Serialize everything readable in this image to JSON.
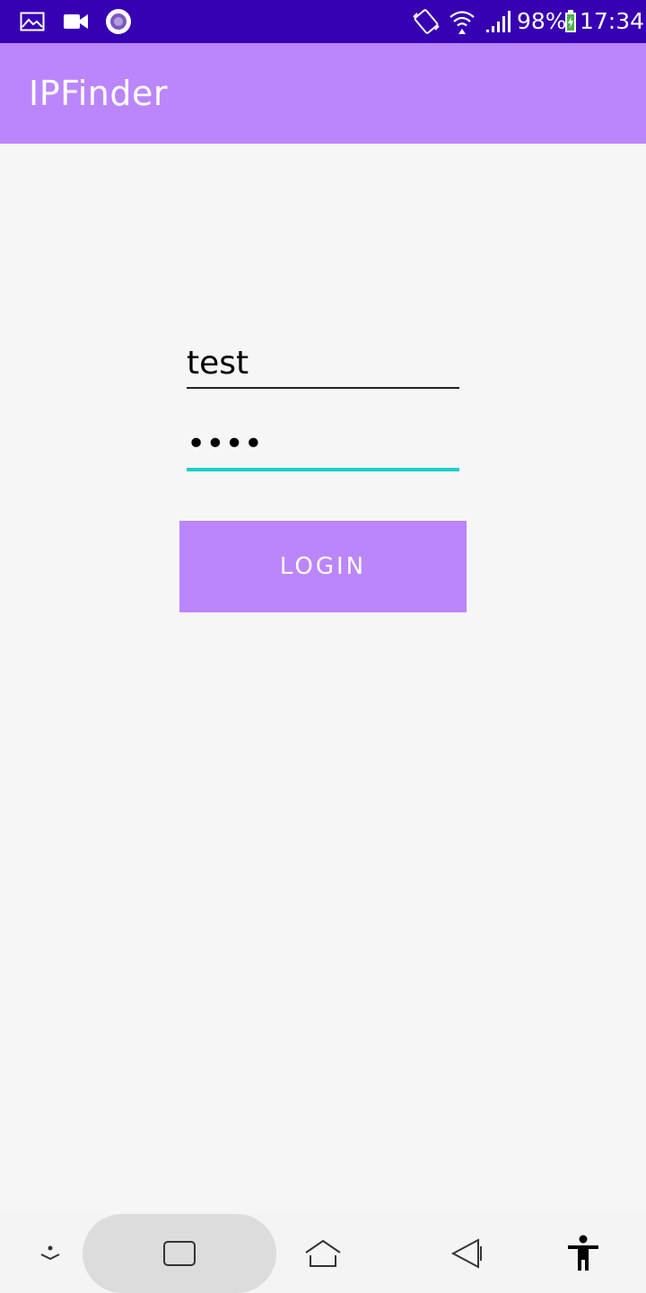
{
  "status_bar": {
    "battery": "98%",
    "time": "17:34",
    "icons": [
      "image-icon",
      "video-camera-icon",
      "record-icon",
      "vibrate-icon",
      "wifi-icon",
      "signal-icon",
      "battery-charging-icon"
    ]
  },
  "app_bar": {
    "title": "IPFinder"
  },
  "form": {
    "username_value": "test",
    "password_value": "test",
    "login_label": "LOGIN"
  },
  "nav_bar": {
    "icons": [
      "hide-bar-icon",
      "recent-apps-icon",
      "home-icon",
      "back-icon",
      "accessibility-icon"
    ]
  },
  "colors": {
    "status_bar": "#3700b3",
    "primary": "#bb86fc",
    "accent": "#1ccfc9",
    "background": "#f6f6f6"
  }
}
